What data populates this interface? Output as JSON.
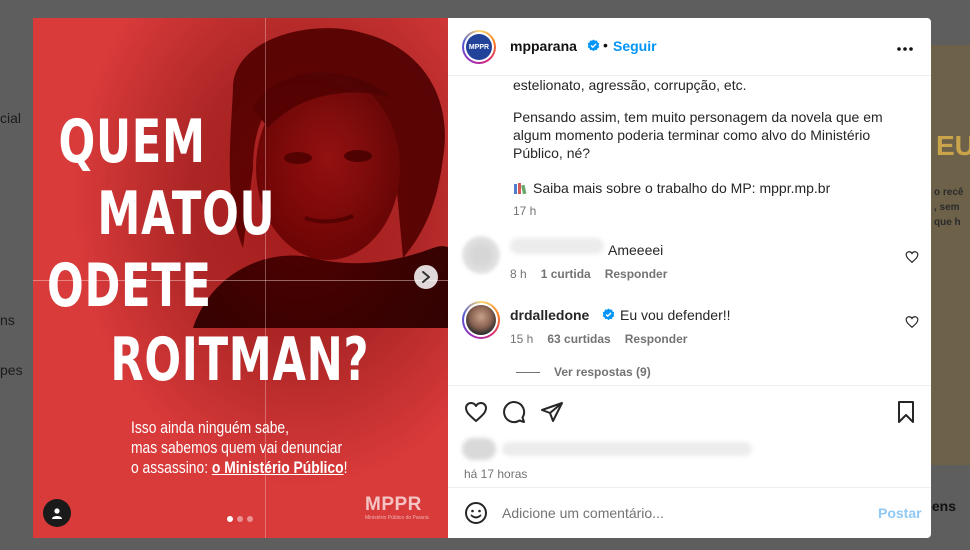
{
  "backdrop": {
    "left_fragments": [
      "cial",
      "ns",
      "pes"
    ],
    "right_word": "EU",
    "right_small": [
      "o recê",
      ", sem",
      "que h"
    ],
    "right_bottom": "ens"
  },
  "post_image": {
    "headline": [
      "QUEM",
      "MATOU",
      "ODETE",
      "ROITMAN?"
    ],
    "subtext_lines": [
      "Isso ainda ninguém sabe,",
      "mas sabemos quem vai denunciar"
    ],
    "subtext_prefix": "o assassino: ",
    "subtext_emphasis": "o Ministério Público",
    "subtext_suffix": "!",
    "brand": "MPPR",
    "brand_sub": "Ministério Público do Paraná"
  },
  "header": {
    "avatar_text": "MPPR",
    "username": "mpparana",
    "follow_label": "Seguir",
    "more_icon": "more-icon"
  },
  "caption": {
    "line1": "estelionato, agressão, corrupção, etc.",
    "line2": "Pensando assim, tem muito personagem da novela que em algum momento poderia terminar como alvo do Ministério Público, né?",
    "line3": "Saiba mais sobre o trabalho do MP: mppr.mp.br",
    "time": "17 h"
  },
  "comments": [
    {
      "username": "",
      "text": "Ameeeei",
      "time": "8 h",
      "likes": "1 curtida",
      "reply": "Responder"
    },
    {
      "username": "drdalledone",
      "text": "Eu vou defender!!",
      "time": "15 h",
      "likes": "63 curtidas",
      "reply": "Responder"
    }
  ],
  "view_replies": "Ver respostas (9)",
  "posted_ago": "há 17 horas",
  "add_comment": {
    "placeholder": "Adicione um comentário...",
    "post_label": "Postar"
  },
  "colors": {
    "accent": "#0095f6",
    "post_disabled": "#90c9f4",
    "image_red": "#d93a3a",
    "verified": "#0095f6"
  }
}
